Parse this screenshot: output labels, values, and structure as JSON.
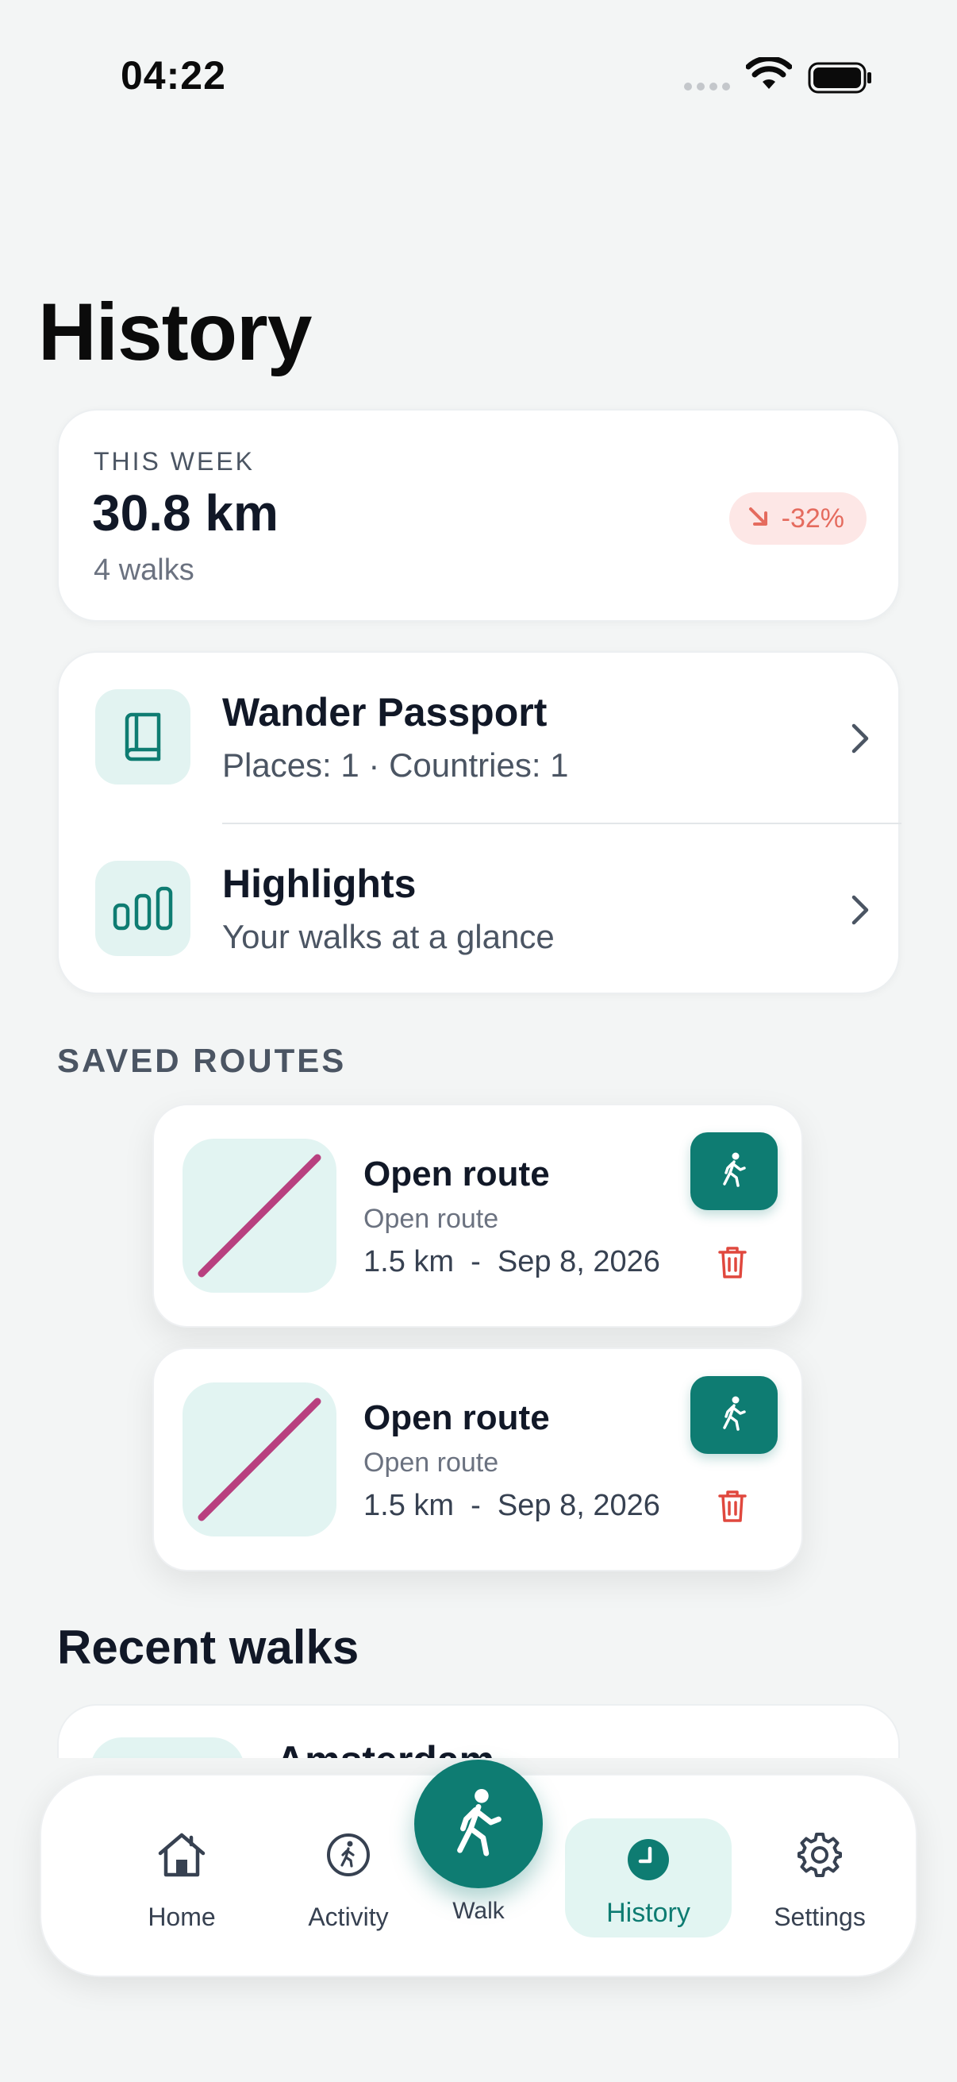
{
  "status_bar": {
    "time": "04:22"
  },
  "page": {
    "title": "History"
  },
  "week_summary": {
    "label": "THIS WEEK",
    "distance": "30.8 km",
    "walks": "4 walks",
    "trend": "-32%",
    "trend_direction": "down",
    "trend_color": "#e56b5e"
  },
  "links": [
    {
      "title": "Wander Passport",
      "subtitle": "Places: 1 · Countries: 1",
      "icon": "book-icon"
    },
    {
      "title": "Highlights",
      "subtitle": "Your walks at a glance",
      "icon": "bar-chart-icon"
    }
  ],
  "saved_routes": {
    "label": "SAVED ROUTES",
    "items": [
      {
        "title": "Open route",
        "subtitle": "Open route",
        "meta": "1.5 km  -  Sep 8, 2026"
      },
      {
        "title": "Open route",
        "subtitle": "Open route",
        "meta": "1.5 km  -  Sep 8, 2026"
      }
    ]
  },
  "recent_walks": {
    "title": "Recent walks",
    "items": [
      {
        "name": "Amsterdam"
      }
    ]
  },
  "tabbar": {
    "home": "Home",
    "activity": "Activity",
    "walk": "Walk",
    "history": "History",
    "settings": "Settings",
    "active": "history"
  },
  "colors": {
    "accent": "#0e7c72",
    "accent_light": "#e2f4f2",
    "route_line": "#b8407f",
    "danger": "#e0483e"
  }
}
